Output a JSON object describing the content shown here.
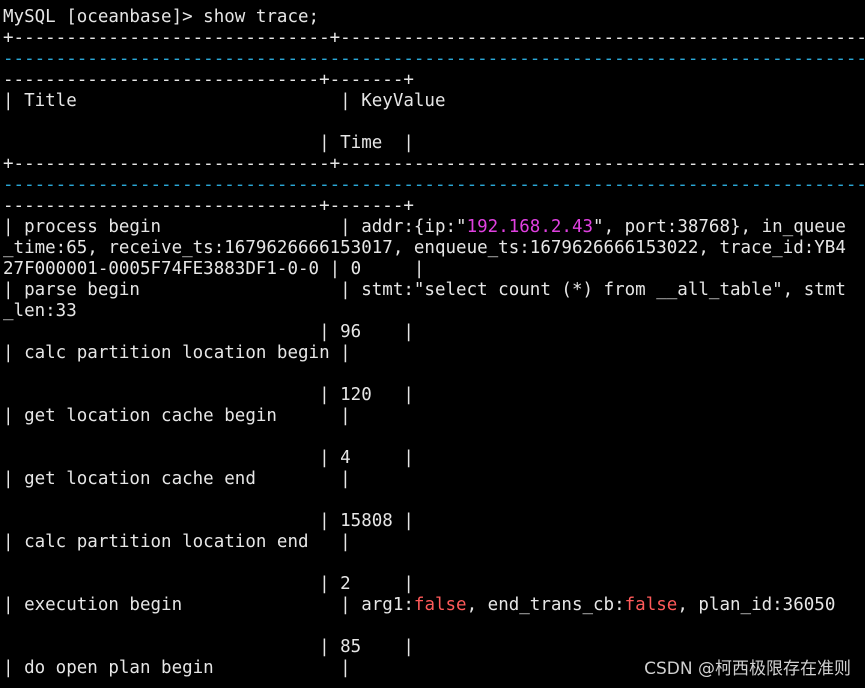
{
  "prompt": {
    "text": "MySQL [oceanbase]> show trace;"
  },
  "colors": {
    "background": "#000000",
    "text": "#e6e6e6",
    "border_wrap": "#2aa7d6",
    "ip_highlight": "#e040e0",
    "false_highlight": "#ff5a5a"
  },
  "table": {
    "border_top": "+------------------------------+---------------------------------------------------",
    "border_wrap": "----------------------------------------------------------------------------------",
    "border_tail": "------------------------------+-------+",
    "header_title_row": "| Title                         | KeyValue",
    "header_time_row": "                              | Time  |",
    "rows": {
      "process_begin_1": "| process begin                 | addr:{ip:\"",
      "process_begin_ip": "192.168.2.43",
      "process_begin_1b": "\", port:38768}, in_queue",
      "process_begin_2": "_time:65, receive_ts:1679626666153017, enqueue_ts:1679626666153022, trace_id:YB4",
      "process_begin_3": "27F000001-0005F74FE3883DF1-0-0 | 0     |",
      "parse_begin_1": "| parse begin                   | stmt:\"select count (*) from __all_table\", stmt",
      "parse_begin_2": "_len:33",
      "parse_begin_3": "                              | 96    |",
      "calc_begin_1": "| calc partition location begin |",
      "calc_begin_2": "                              | 120   |",
      "get_cache_begin_1": "| get location cache begin      |",
      "get_cache_begin_2": "                              | 4     |",
      "get_cache_end_1": "| get location cache end        |",
      "get_cache_end_2": "                              | 15808 |",
      "calc_end_1": "| calc partition location end   |",
      "calc_end_2": "                              | 2     |",
      "exec_begin_a": "| execution begin               | arg1:",
      "exec_begin_false1": "false",
      "exec_begin_b": ", end_trans_cb:",
      "exec_begin_false2": "false",
      "exec_begin_c": ", plan_id:36050",
      "exec_begin_2": "                              | 85    |",
      "open_plan_1": "| do open plan begin            |"
    }
  },
  "watermark": {
    "text": "CSDN @柯西极限存在准则"
  }
}
